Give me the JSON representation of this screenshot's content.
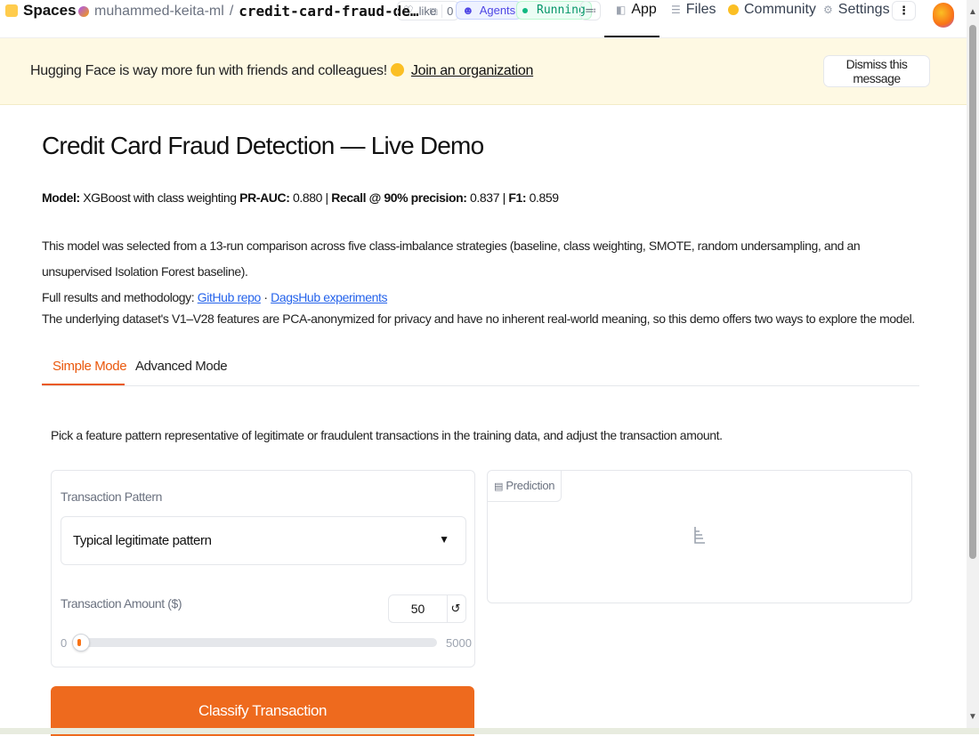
{
  "nav": {
    "spaces": "Spaces",
    "owner": "muhammed-keita-ml",
    "separator": "/",
    "repo": "credit-card-fraud-de…",
    "like_label": "like",
    "like_count": "0",
    "agents": "Agents",
    "status": "Running",
    "tabs": [
      "App",
      "Files",
      "Community",
      "Settings"
    ],
    "more": "⋮"
  },
  "banner": {
    "message": "Hugging Face is way more fun with friends and colleagues!",
    "link": "Join an organization",
    "dismiss": "Dismiss this message"
  },
  "main": {
    "title": "Credit Card Fraud Detection — Live Demo",
    "metrics": {
      "model_label": "Model:",
      "model_value": "XGBoost with class weighting",
      "prauc_label": "PR-AUC:",
      "prauc_value": "0.880 |",
      "recall_label": "Recall @ 90% precision:",
      "recall_value": "0.837 |",
      "f1_label": "F1:",
      "f1_value": "0.859"
    },
    "para1": "This model was selected from a 13-run comparison across five class-imbalance strategies (baseline, class weighting, SMOTE, random undersampling, and an unsupervised Isolation Forest baseline).",
    "para1b": "Full results and methodology:",
    "github_link": "GitHub repo",
    "dot_sep": "·",
    "dagshub_link": "DagsHub experiments",
    "para2": "The underlying dataset's V1–V28 features are PCA-anonymized for privacy and have no inherent real-world meaning, so this demo offers two ways to explore the model.",
    "tabs": [
      "Simple Mode",
      "Advanced Mode"
    ],
    "hint": "Pick a feature pattern representative of legitimate or fraudulent transactions in the training data, and adjust the transaction amount."
  },
  "form": {
    "pattern_label": "Transaction Pattern",
    "pattern_value": "Typical legitimate pattern",
    "amount_label": "Transaction Amount ($)",
    "amount_value": "50",
    "reset_icon": "↺",
    "range_min": "0",
    "range_max": "5000",
    "slider_fraction": 0.01
  },
  "prediction": {
    "label": "Prediction"
  },
  "classify_label": "Classify Transaction",
  "colors": {
    "accent": "#ee6a1e",
    "banner_bg": "#fef9e3",
    "link": "#2563eb"
  }
}
